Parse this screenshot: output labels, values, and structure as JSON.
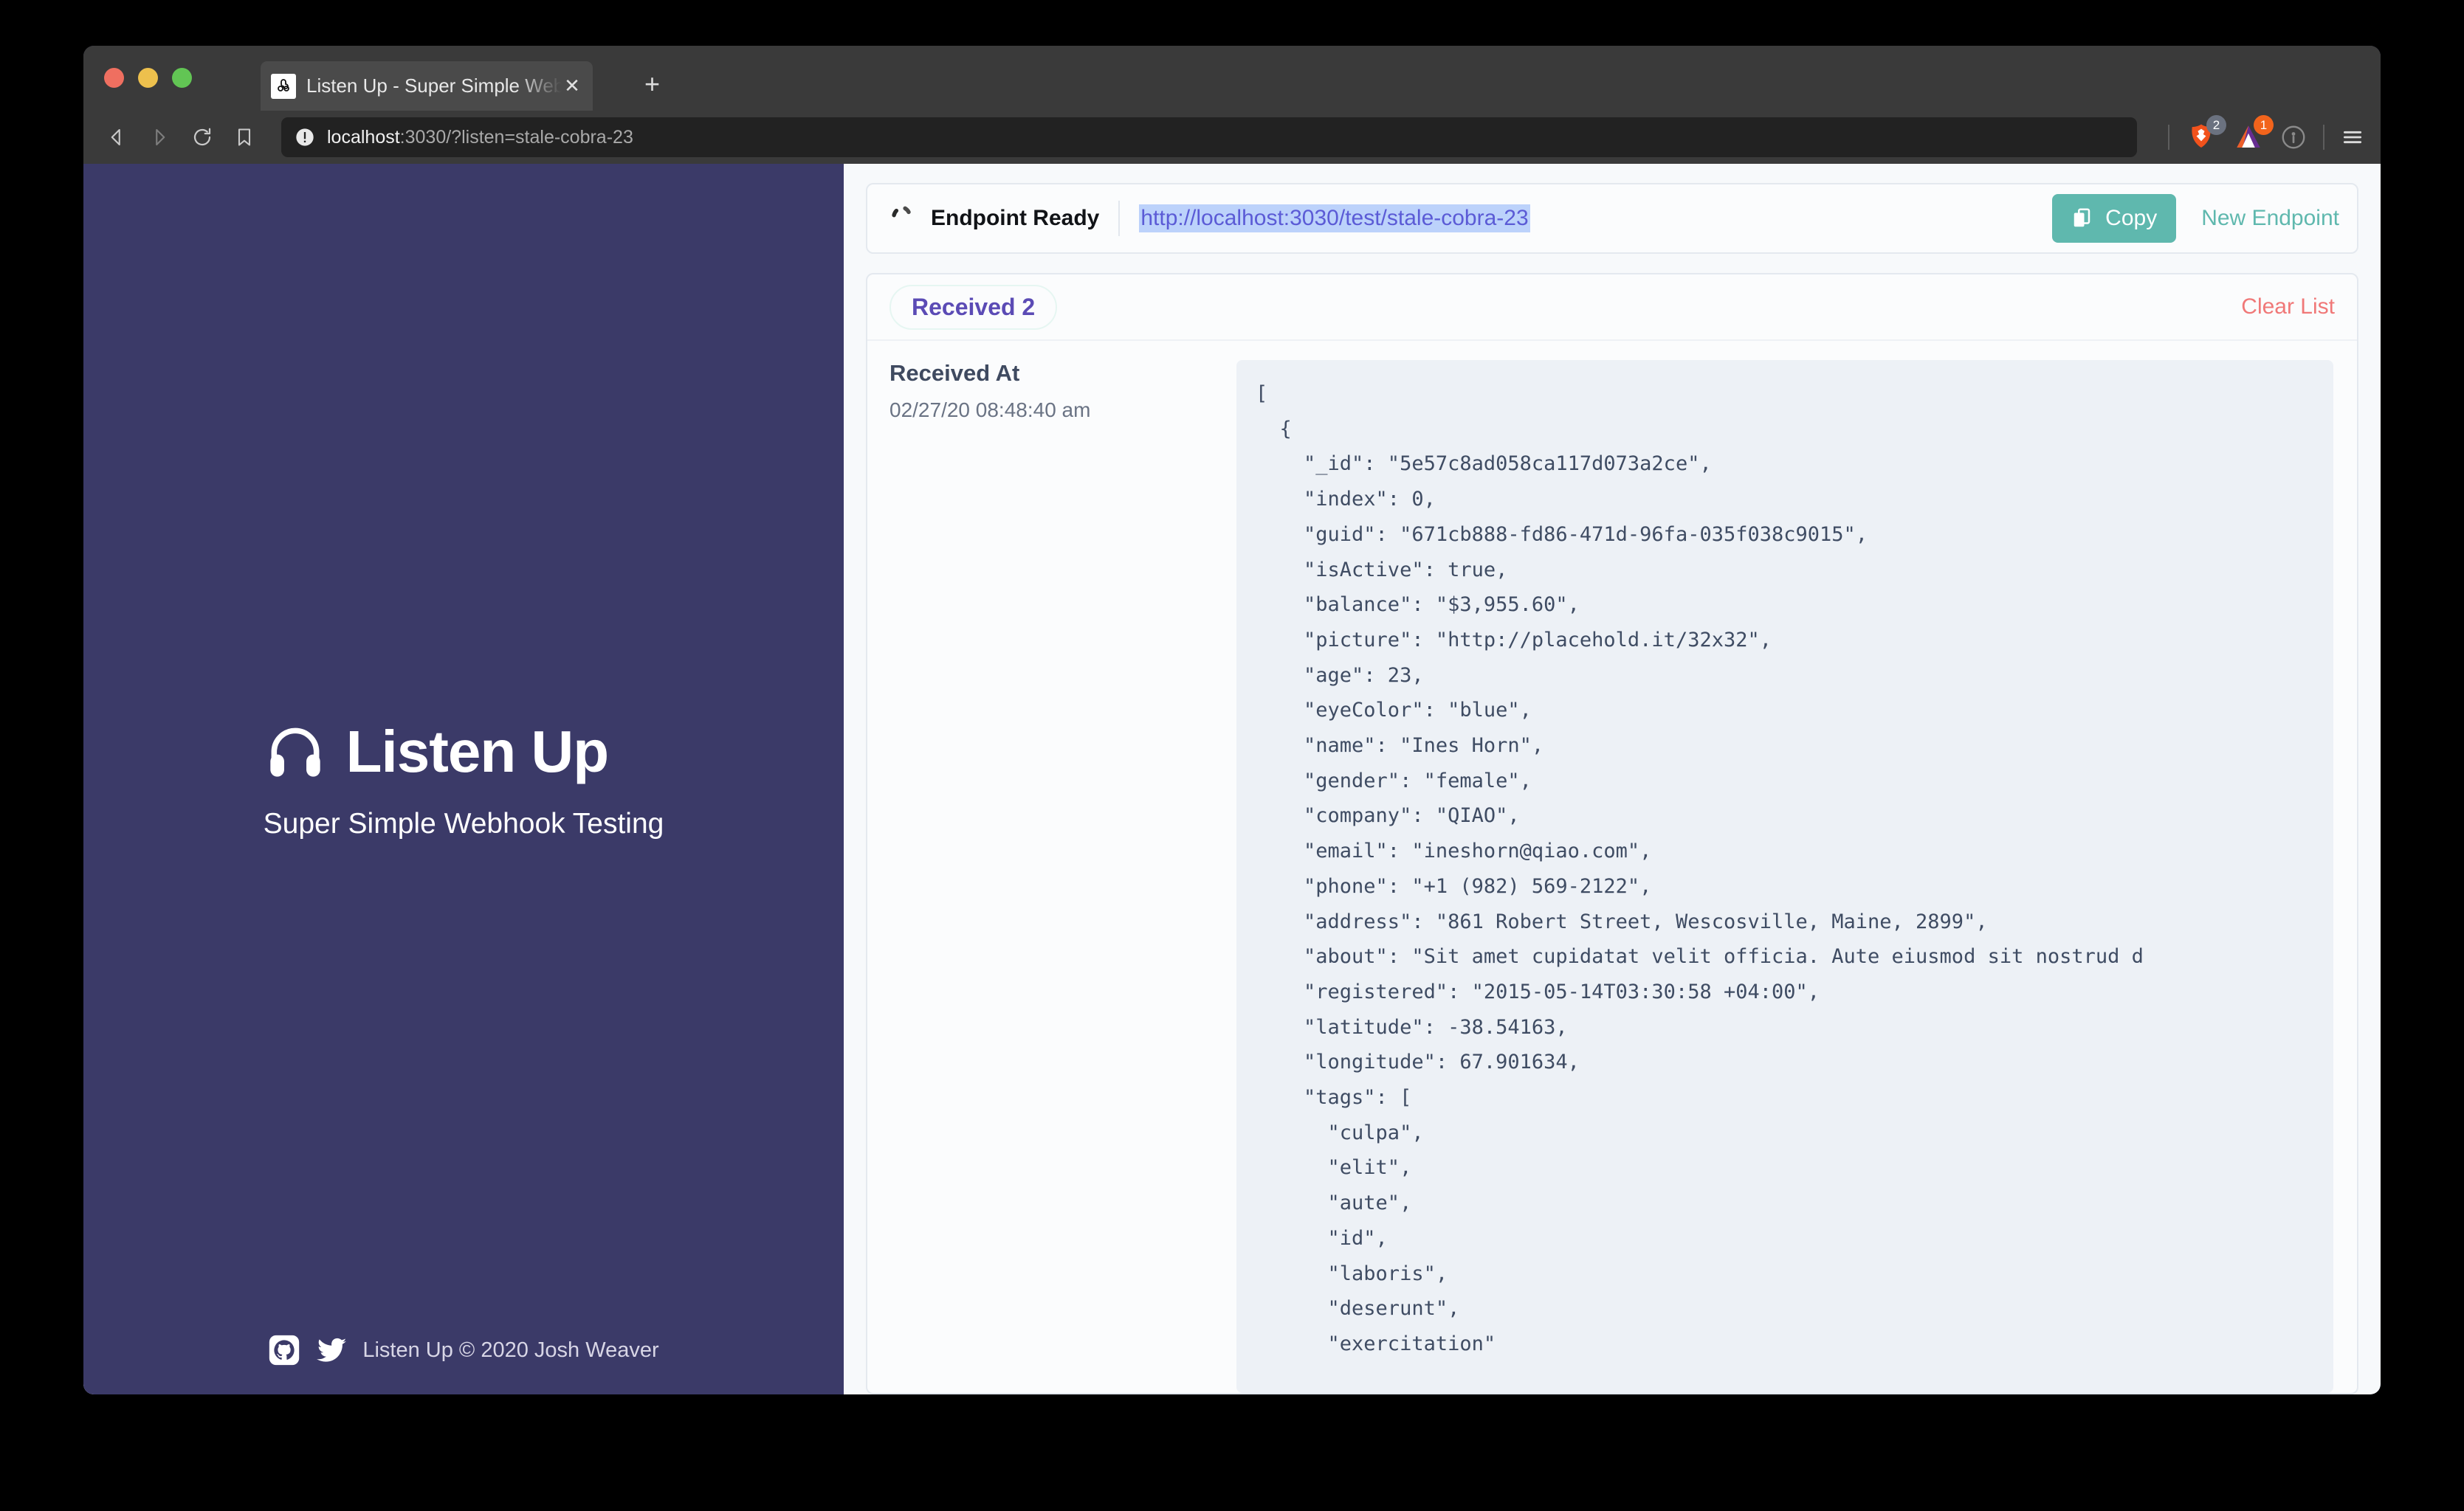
{
  "browser": {
    "tab_title": "Listen Up - Super Simple Webhook Testing",
    "tab_close_label": "✕",
    "new_tab_label": "+",
    "url_host": "localhost",
    "url_path": ":3030/?listen=stale-cobra-23",
    "shield_badge": "2",
    "rewards_badge": "1",
    "icons": {
      "back": "back-arrow-icon",
      "forward": "forward-arrow-icon",
      "reload": "reload-icon",
      "bookmark": "bookmark-icon",
      "site_info": "site-info-icon",
      "shield": "brave-shield-icon",
      "rewards": "brave-rewards-icon",
      "profile": "profile-icon",
      "menu": "hamburger-menu-icon"
    }
  },
  "sidebar": {
    "brand_name": "Listen Up",
    "tagline": "Super Simple Webhook Testing",
    "footer_text": "Listen Up © 2020 Josh Weaver",
    "github_label": "github-icon",
    "twitter_label": "twitter-icon",
    "headphones_label": "headphones-icon",
    "background_color": "#3b3a68"
  },
  "endpoint": {
    "status_text": "Endpoint Ready",
    "url": "http://localhost:3030/test/stale-cobra-23",
    "copy_label": "Copy",
    "new_endpoint_label": "New Endpoint",
    "accent_color": "#5fb8ae",
    "selection_color": "#bcd2fb"
  },
  "received": {
    "title": "Received 2",
    "clear_label": "Clear List",
    "meta_label": "Received At",
    "meta_value": "02/27/20 08:48:40 am",
    "title_color": "#5b4bb5",
    "clear_color": "#f07878",
    "payload": "[\n  {\n    \"_id\": \"5e57c8ad058ca117d073a2ce\",\n    \"index\": 0,\n    \"guid\": \"671cb888-fd86-471d-96fa-035f038c9015\",\n    \"isActive\": true,\n    \"balance\": \"$3,955.60\",\n    \"picture\": \"http://placehold.it/32x32\",\n    \"age\": 23,\n    \"eyeColor\": \"blue\",\n    \"name\": \"Ines Horn\",\n    \"gender\": \"female\",\n    \"company\": \"QIAO\",\n    \"email\": \"ineshorn@qiao.com\",\n    \"phone\": \"+1 (982) 569-2122\",\n    \"address\": \"861 Robert Street, Wescosville, Maine, 2899\",\n    \"about\": \"Sit amet cupidatat velit officia. Aute eiusmod sit nostrud d\n    \"registered\": \"2015-05-14T03:30:58 +04:00\",\n    \"latitude\": -38.54163,\n    \"longitude\": 67.901634,\n    \"tags\": [\n      \"culpa\",\n      \"elit\",\n      \"aute\",\n      \"id\",\n      \"laboris\",\n      \"deserunt\",\n      \"exercitation\""
  }
}
